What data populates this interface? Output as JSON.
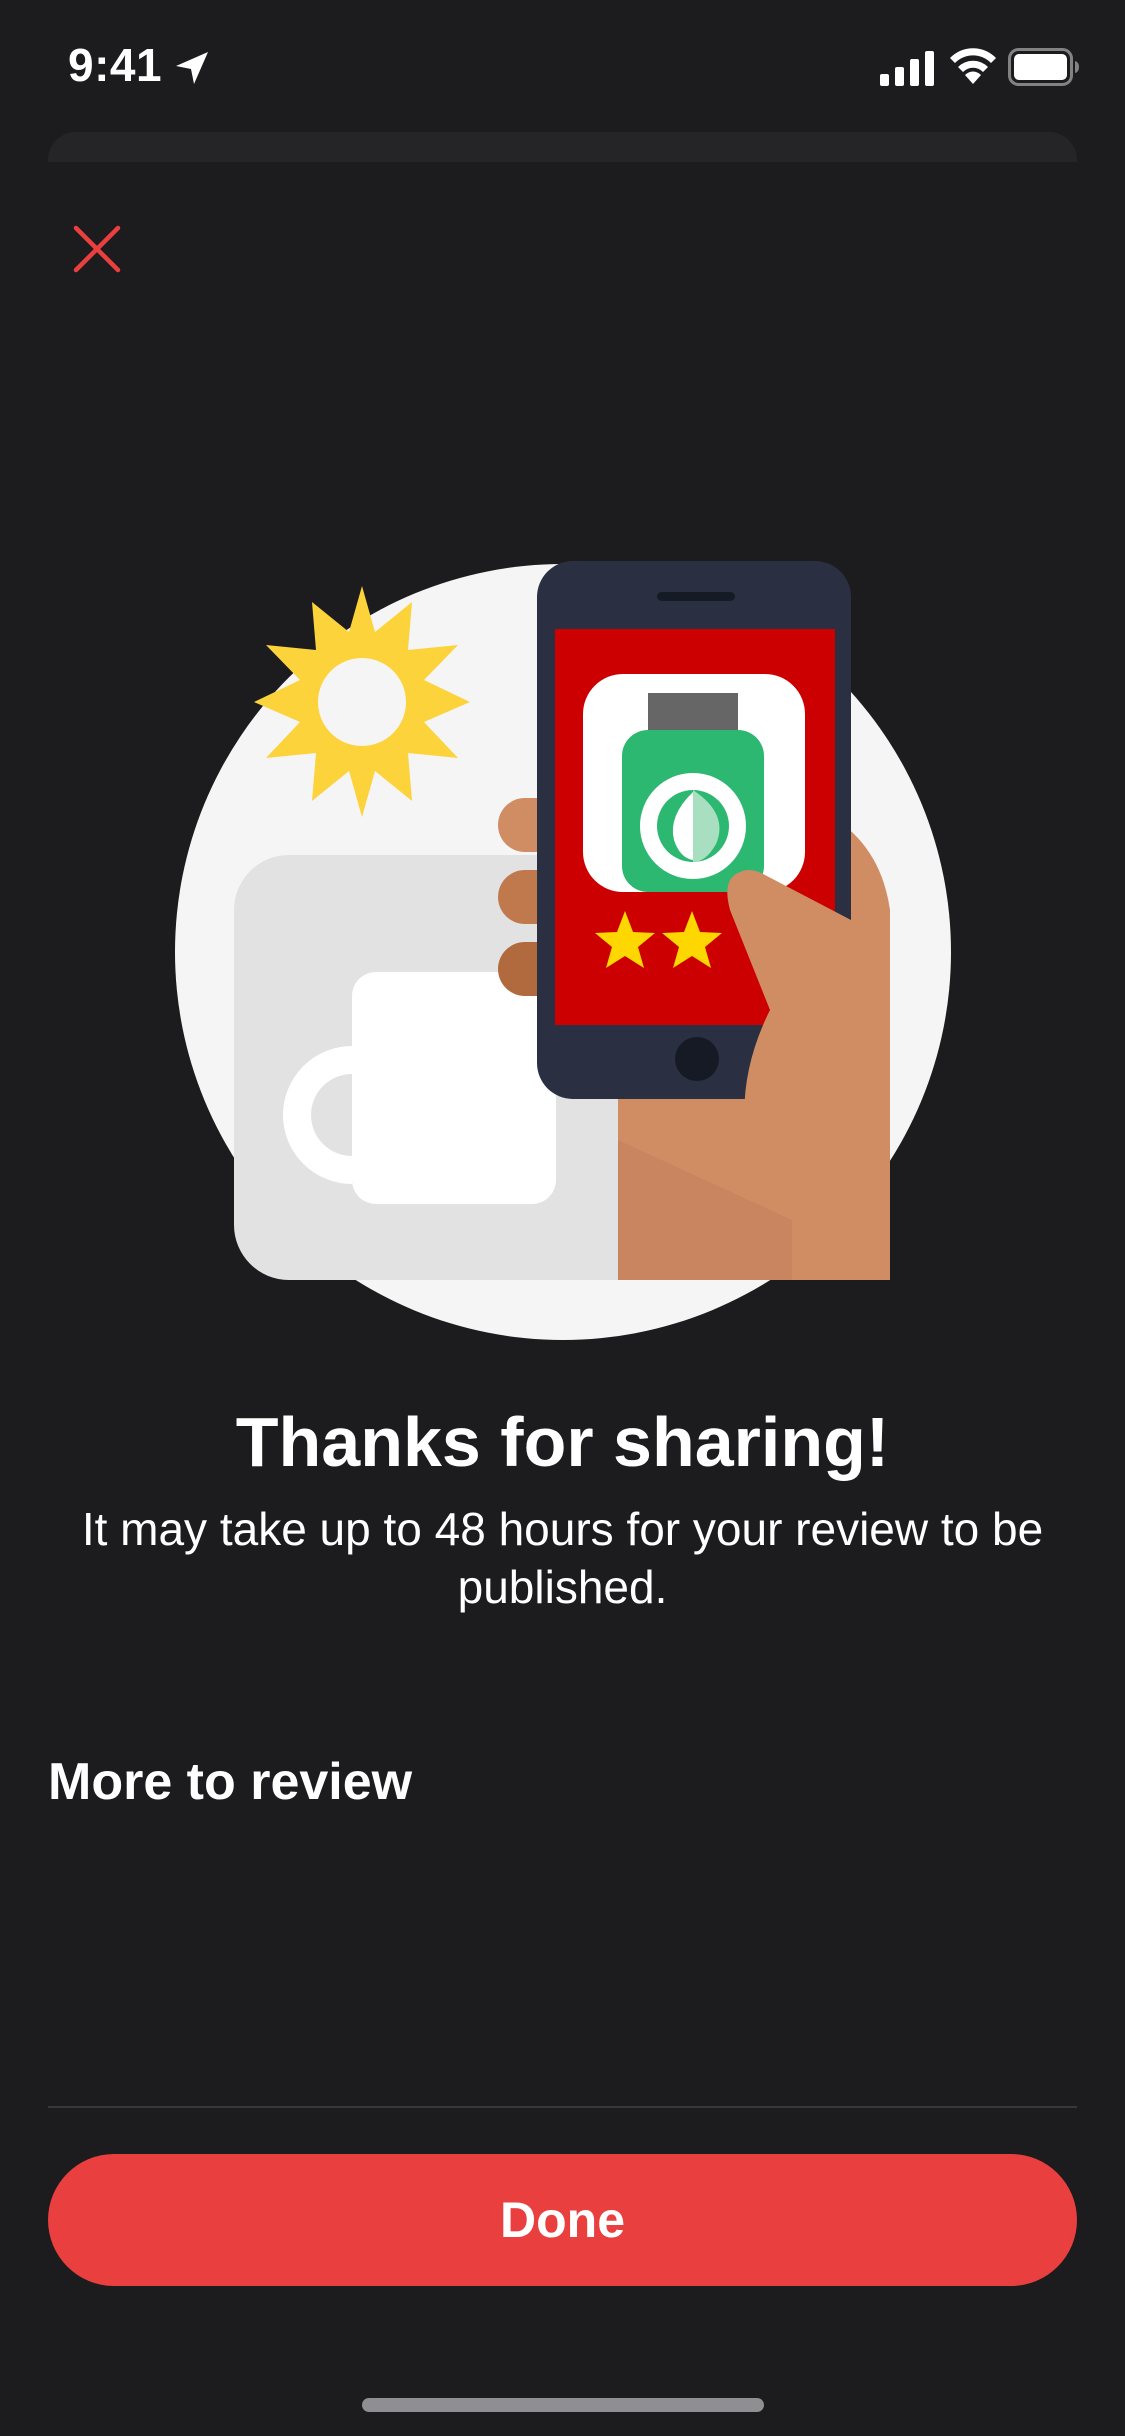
{
  "status_bar": {
    "time": "9:41",
    "icons": [
      "location-arrow-icon",
      "cellular-signal-icon",
      "wifi-icon",
      "battery-icon"
    ]
  },
  "header": {
    "close_icon": "close-icon"
  },
  "colors": {
    "background": "#1c1c1e",
    "accent": "#ea3f3f",
    "phone_screen": "#cc0000",
    "app_icon_green": "#2db872",
    "sun_yellow": "#fdd33b",
    "star_yellow": "#ffd700",
    "skin": "#d08c62"
  },
  "illustration": {
    "stars_shown": 2
  },
  "confirmation": {
    "title": "Thanks for sharing!",
    "message": "It may take up to 48 hours for your review to be published."
  },
  "more_to_review": {
    "heading": "More to review"
  },
  "footer": {
    "done_label": "Done"
  }
}
